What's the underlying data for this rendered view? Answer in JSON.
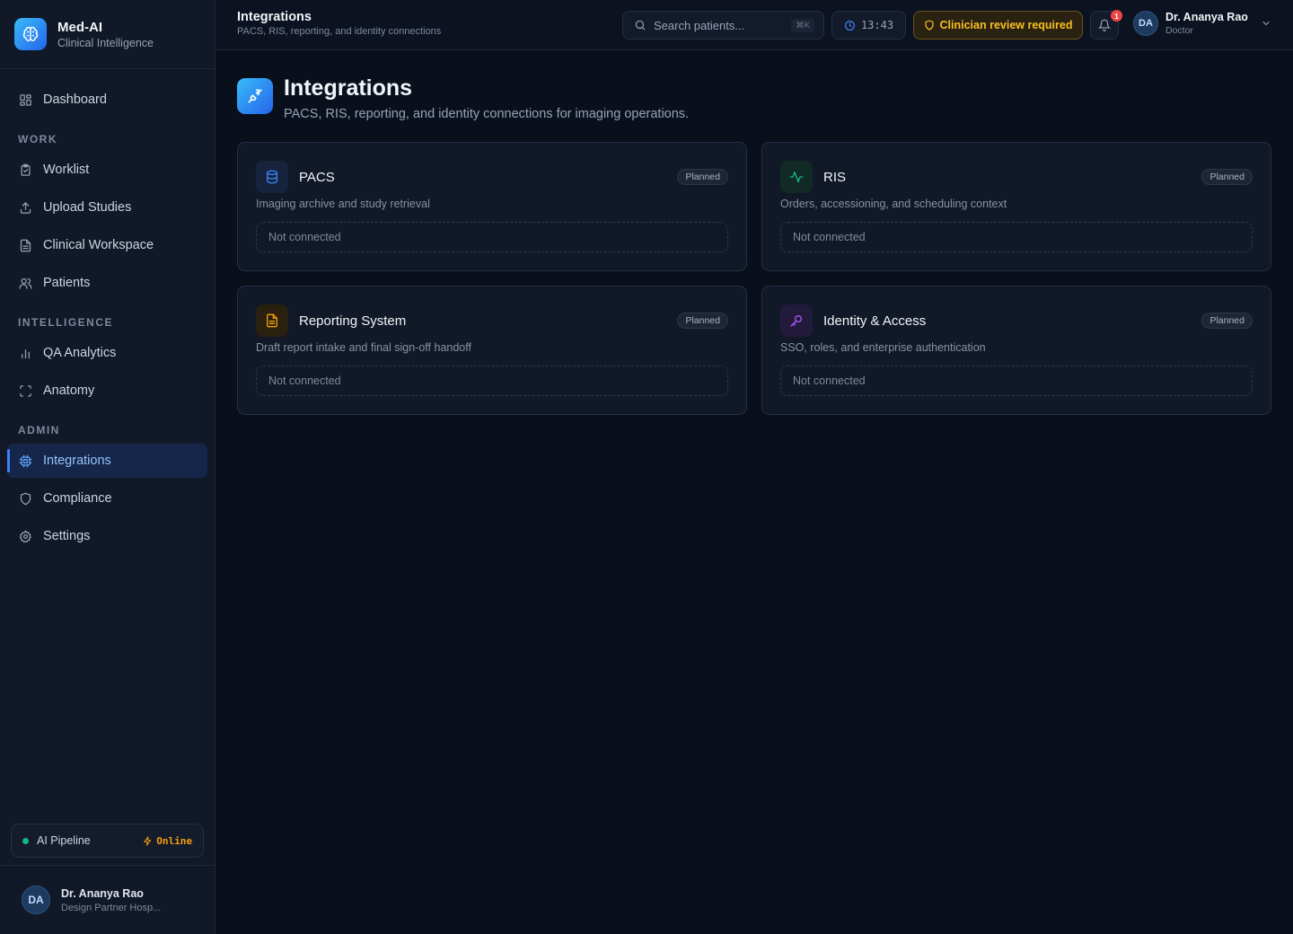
{
  "brand": {
    "name": "Med-AI",
    "subtitle": "Clinical Intelligence"
  },
  "sidebar": {
    "dashboard": {
      "label": "Dashboard",
      "icon": "grid-icon"
    },
    "sections": [
      {
        "title": "WORK",
        "items": [
          {
            "label": "Worklist",
            "icon": "clipboard-icon"
          },
          {
            "label": "Upload Studies",
            "icon": "upload-icon"
          },
          {
            "label": "Clinical Workspace",
            "icon": "file-icon"
          },
          {
            "label": "Patients",
            "icon": "users-icon"
          }
        ]
      },
      {
        "title": "INTELLIGENCE",
        "items": [
          {
            "label": "QA Analytics",
            "icon": "bar-chart-icon"
          },
          {
            "label": "Anatomy",
            "icon": "scan-icon"
          }
        ]
      },
      {
        "title": "ADMIN",
        "items": [
          {
            "label": "Integrations",
            "icon": "cpu-icon",
            "active": true
          },
          {
            "label": "Compliance",
            "icon": "shield-icon"
          },
          {
            "label": "Settings",
            "icon": "gear-icon"
          }
        ]
      }
    ],
    "pipeline": {
      "label": "AI Pipeline",
      "status": "Online"
    },
    "user": {
      "initials": "DA",
      "name": "Dr. Ananya Rao",
      "org": "Design Partner Hosp..."
    }
  },
  "topbar": {
    "title": "Integrations",
    "subtitle": "PACS, RIS, reporting, and identity connections",
    "search_placeholder": "Search patients...",
    "search_shortcut": "⌘K",
    "time": "13:43",
    "review_label": "Clinician review required",
    "notification_count": "1",
    "user": {
      "initials": "DA",
      "name": "Dr. Ananya Rao",
      "role": "Doctor"
    }
  },
  "page": {
    "title": "Integrations",
    "subtitle": "PACS, RIS, reporting, and identity connections for imaging operations."
  },
  "integrations": [
    {
      "name": "PACS",
      "description": "Imaging archive and study retrieval",
      "badge": "Planned",
      "status": "Not connected",
      "icon": "database-icon",
      "color": "#3b82f6"
    },
    {
      "name": "RIS",
      "description": "Orders, accessioning, and scheduling context",
      "badge": "Planned",
      "status": "Not connected",
      "icon": "activity-icon",
      "color": "#10b981"
    },
    {
      "name": "Reporting System",
      "description": "Draft report intake and final sign-off handoff",
      "badge": "Planned",
      "status": "Not connected",
      "icon": "document-icon",
      "color": "#f59e0b"
    },
    {
      "name": "Identity & Access",
      "description": "SSO, roles, and enterprise authentication",
      "badge": "Planned",
      "status": "Not connected",
      "icon": "key-icon",
      "color": "#a855f7"
    }
  ],
  "colors": {
    "accent": "#3b82f6",
    "background": "#0a0f1c",
    "warning": "#fbbf24",
    "success": "#10b981"
  }
}
